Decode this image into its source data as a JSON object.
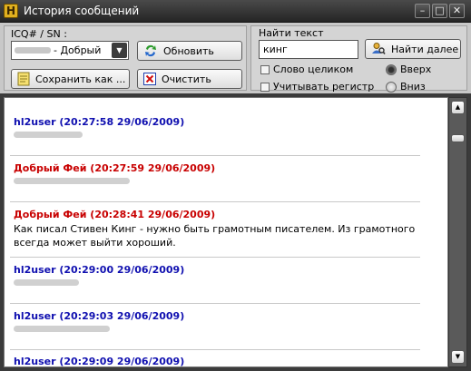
{
  "window": {
    "title": "История сообщений",
    "app_icon_glyph": "H",
    "controls": {
      "minimize": "–",
      "maximize": "□",
      "close": "✕"
    }
  },
  "contact": {
    "label": "ICQ# / SN :",
    "selected_nick": "- Добрый",
    "refresh_button": "Обновить",
    "save_button": "Сохранить как ...",
    "clear_button": "Очистить"
  },
  "find": {
    "label": "Найти текст",
    "query": "кинг",
    "find_next_button": "Найти далее",
    "whole_word_label": "Слово целиком",
    "match_case_label": "Учитывать регистр",
    "direction_up_label": "Вверх",
    "direction_down_label": "Вниз",
    "whole_word_checked": false,
    "match_case_checked": false,
    "direction": "up"
  },
  "messages": [
    {
      "sender": "hl2user",
      "header": "hl2user (20:27:58 29/06/2009)",
      "color": "#1010b0",
      "text": ""
    },
    {
      "sender": "Добрый Фей",
      "header": "Добрый Фей (20:27:59 29/06/2009)",
      "color": "#c80000",
      "text": ""
    },
    {
      "sender": "Добрый Фей",
      "header": "Добрый Фей (20:28:41 29/06/2009)",
      "color": "#c80000",
      "text": "Как писал Стивен Кинг - нужно быть грамотным писателем. Из грамотного всегда может выйти хороший."
    },
    {
      "sender": "hl2user",
      "header": "hl2user (20:29:00 29/06/2009)",
      "color": "#1010b0",
      "text": ""
    },
    {
      "sender": "hl2user",
      "header": "hl2user (20:29:03 29/06/2009)",
      "color": "#1010b0",
      "text": ""
    },
    {
      "sender": "hl2user",
      "header": "hl2user (20:29:09 29/06/2009)",
      "color": "#1010b0",
      "text": ""
    }
  ],
  "icons": {
    "refresh": "refresh-icon",
    "save": "save-document-icon",
    "clear": "clear-icon",
    "find": "find-user-icon"
  }
}
